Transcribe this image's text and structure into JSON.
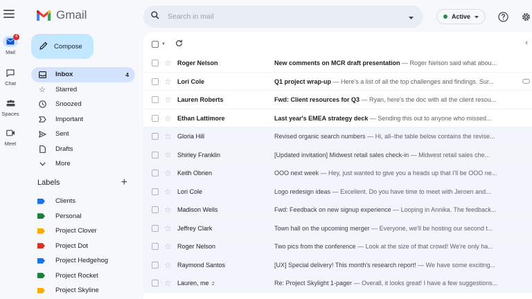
{
  "app": {
    "name": "Gmail",
    "colors": {
      "accent": "#c2e7ff",
      "nav_active": "#d3e3fd",
      "status": "#1e8e3e",
      "badge": "#d93025"
    }
  },
  "rail": {
    "items": [
      {
        "label": "Mail",
        "icon": "mail-icon",
        "badge": "4"
      },
      {
        "label": "Chat",
        "icon": "chat-icon"
      },
      {
        "label": "Spaces",
        "icon": "spaces-icon"
      },
      {
        "label": "Meet",
        "icon": "video-icon"
      }
    ]
  },
  "compose": {
    "label": "Compose",
    "icon": "pencil-icon"
  },
  "search": {
    "placeholder": "Search in mail",
    "icon": "search-icon",
    "options_icon": "caret-down-icon"
  },
  "status": {
    "label": "Active",
    "icon": "chevron-down-icon"
  },
  "topbar": {
    "help_icon": "help-icon",
    "settings_icon": "gear-icon"
  },
  "nav": {
    "items": [
      {
        "label": "Inbox",
        "icon": "inbox-icon",
        "count": "4",
        "active": true
      },
      {
        "label": "Starred",
        "icon": "star-icon"
      },
      {
        "label": "Snoozed",
        "icon": "clock-icon"
      },
      {
        "label": "Important",
        "icon": "important-icon"
      },
      {
        "label": "Sent",
        "icon": "send-icon"
      },
      {
        "label": "Drafts",
        "icon": "draft-icon"
      },
      {
        "label": "More",
        "icon": "chevron-down-icon"
      }
    ]
  },
  "labels": {
    "title": "Labels",
    "items": [
      {
        "name": "Clients",
        "color": "#1a73e8"
      },
      {
        "name": "Personal",
        "color": "#188038"
      },
      {
        "name": "Project Clover",
        "color": "#f9ab00"
      },
      {
        "name": "Project Dot",
        "color": "#d93025"
      },
      {
        "name": "Project Hedgehog",
        "color": "#1a73e8"
      },
      {
        "name": "Project Rocket",
        "color": "#188038"
      },
      {
        "name": "Project Skyline",
        "color": "#f9ab00"
      }
    ]
  },
  "toolbar": {
    "select_icon": "checkbox-icon",
    "refresh_icon": "refresh-icon",
    "collapse_icon": "chevron-left-icon"
  },
  "emails": [
    {
      "sender": "Roger Nelson",
      "subject": "New comments on MCR draft presentation",
      "snippet": " — Roger Nelson said what abou...",
      "unread": true
    },
    {
      "sender": "Lori Cole",
      "subject": "Q1 project wrap-up",
      "snippet": " — Here's a list of all the top challenges and findings. Sur...",
      "unread": true,
      "attachment": true
    },
    {
      "sender": "Lauren Roberts",
      "subject": "Fwd: Client resources for Q3",
      "snippet": " — Ryan, here's the doc with all the client resou...",
      "unread": true
    },
    {
      "sender": "Ethan Lattimore",
      "subject": "Last year's EMEA strategy deck",
      "snippet": " — Sending this out to anyone who missed...",
      "unread": true
    },
    {
      "sender": "Gloria Hill",
      "subject": "Revised organic search numbers",
      "snippet": " — Hi, all–the table below contains the revise...",
      "unread": false
    },
    {
      "sender": "Shirley Franklin",
      "subject": "[Updated invitation] Midwest retail sales check-in",
      "snippet": " — Midwest retail sales che...",
      "unread": false
    },
    {
      "sender": "Keith Obrien",
      "subject": "OOO next week",
      "snippet": " — Hey, just wanted to give you a heads up that I'll be OOO ne...",
      "unread": false
    },
    {
      "sender": "Lori Cole",
      "subject": "Logo redesign ideas",
      "snippet": " — Excellent. Do you have time to meet with Jeroen and...",
      "unread": false
    },
    {
      "sender": "Madison Wells",
      "subject": "Fwd: Feedback on new signup experience",
      "snippet": " — Looping in Annika. The feedback...",
      "unread": false
    },
    {
      "sender": "Jeffrey Clark",
      "subject": "Town hall on the upcoming merger",
      "snippet": " — Everyone, we'll be hosting our second t...",
      "unread": false
    },
    {
      "sender": "Roger Nelson",
      "subject": "Two pics from the conference",
      "snippet": " — Look at the size of that crowd! We're only ha...",
      "unread": false
    },
    {
      "sender": "Raymond Santos",
      "subject": "[UX] Special delivery! This month's research report!",
      "snippet": " — We have some exciting...",
      "unread": false
    },
    {
      "sender": "Lauren, me",
      "thread_count": "2",
      "subject": "Re: Project Skylight 1-pager",
      "snippet": " — Overall, it looks great! I have a few suggestions...",
      "unread": false
    }
  ]
}
